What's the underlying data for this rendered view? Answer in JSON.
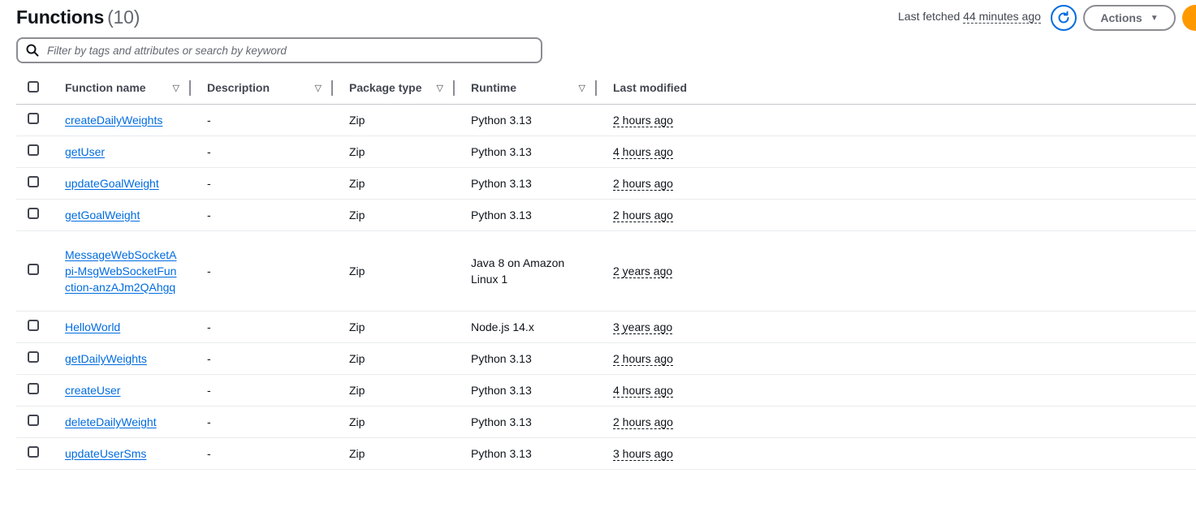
{
  "header": {
    "title": "Functions",
    "count": "(10)",
    "last_fetched_label": "Last fetched",
    "last_fetched_ago": "44 minutes ago",
    "actions_label": "Actions"
  },
  "search": {
    "placeholder": "Filter by tags and attributes or search by keyword",
    "value": ""
  },
  "table": {
    "columns": [
      "Function name",
      "Description",
      "Package type",
      "Runtime",
      "Last modified"
    ],
    "rows": [
      {
        "name": "createDailyWeights",
        "description": "-",
        "package": "Zip",
        "runtime": "Python 3.13",
        "modified": "2 hours ago"
      },
      {
        "name": "getUser",
        "description": "-",
        "package": "Zip",
        "runtime": "Python 3.13",
        "modified": "4 hours ago"
      },
      {
        "name": "updateGoalWeight",
        "description": "-",
        "package": "Zip",
        "runtime": "Python 3.13",
        "modified": "2 hours ago"
      },
      {
        "name": "getGoalWeight",
        "description": "-",
        "package": "Zip",
        "runtime": "Python 3.13",
        "modified": "2 hours ago"
      },
      {
        "name": "MessageWebSocketApi-MsgWebSocketFunction-anzAJm2QAhgq",
        "description": "-",
        "package": "Zip",
        "runtime": "Java 8 on Amazon Linux 1",
        "modified": "2 years ago"
      },
      {
        "name": "HelloWorld",
        "description": "-",
        "package": "Zip",
        "runtime": "Node.js 14.x",
        "modified": "3 years ago"
      },
      {
        "name": "getDailyWeights",
        "description": "-",
        "package": "Zip",
        "runtime": "Python 3.13",
        "modified": "2 hours ago"
      },
      {
        "name": "createUser",
        "description": "-",
        "package": "Zip",
        "runtime": "Python 3.13",
        "modified": "4 hours ago"
      },
      {
        "name": "deleteDailyWeight",
        "description": "-",
        "package": "Zip",
        "runtime": "Python 3.13",
        "modified": "2 hours ago"
      },
      {
        "name": "updateUserSms",
        "description": "-",
        "package": "Zip",
        "runtime": "Python 3.13",
        "modified": "3 hours ago"
      }
    ]
  },
  "colors": {
    "link": "#006ce0",
    "text": "#0f141a",
    "border": "#8c8c94",
    "primary_button": "#ff9900"
  },
  "icons": [
    "search-icon",
    "refresh-icon",
    "caret-down-icon",
    "sort-icon"
  ]
}
